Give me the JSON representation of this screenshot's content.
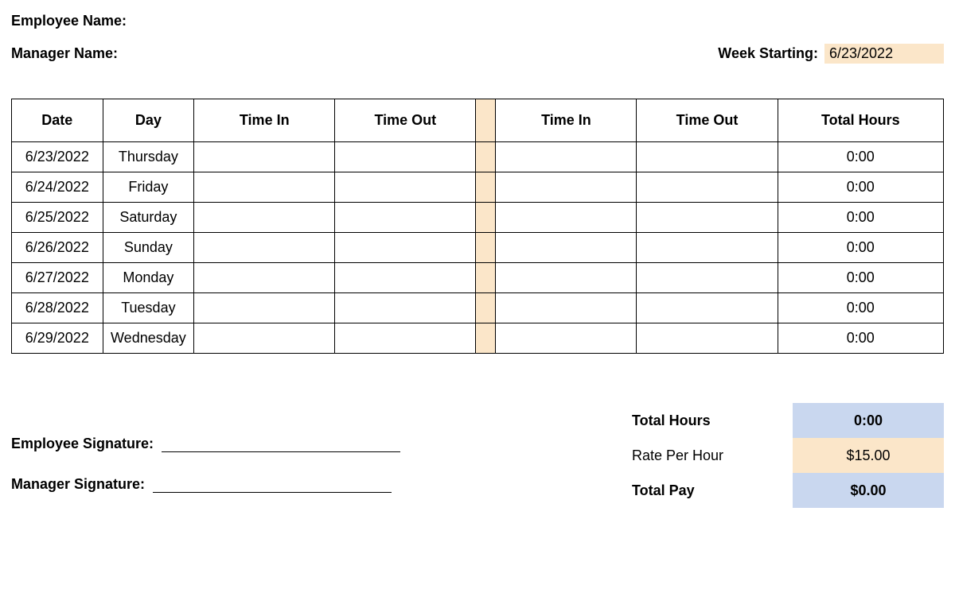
{
  "header": {
    "employee_name_label": "Employee Name:",
    "manager_name_label": "Manager Name:",
    "week_starting_label": "Week Starting:",
    "week_starting_value": "6/23/2022"
  },
  "table": {
    "headers": {
      "date": "Date",
      "day": "Day",
      "time_in_1": "Time In",
      "time_out_1": "Time Out",
      "time_in_2": "Time In",
      "time_out_2": "Time Out",
      "total_hours": "Total Hours"
    },
    "rows": [
      {
        "date": "6/23/2022",
        "day": "Thursday",
        "time_in_1": "",
        "time_out_1": "",
        "time_in_2": "",
        "time_out_2": "",
        "total": "0:00"
      },
      {
        "date": "6/24/2022",
        "day": "Friday",
        "time_in_1": "",
        "time_out_1": "",
        "time_in_2": "",
        "time_out_2": "",
        "total": "0:00"
      },
      {
        "date": "6/25/2022",
        "day": "Saturday",
        "time_in_1": "",
        "time_out_1": "",
        "time_in_2": "",
        "time_out_2": "",
        "total": "0:00"
      },
      {
        "date": "6/26/2022",
        "day": "Sunday",
        "time_in_1": "",
        "time_out_1": "",
        "time_in_2": "",
        "time_out_2": "",
        "total": "0:00"
      },
      {
        "date": "6/27/2022",
        "day": "Monday",
        "time_in_1": "",
        "time_out_1": "",
        "time_in_2": "",
        "time_out_2": "",
        "total": "0:00"
      },
      {
        "date": "6/28/2022",
        "day": "Tuesday",
        "time_in_1": "",
        "time_out_1": "",
        "time_in_2": "",
        "time_out_2": "",
        "total": "0:00"
      },
      {
        "date": "6/29/2022",
        "day": "Wednesday",
        "time_in_1": "",
        "time_out_1": "",
        "time_in_2": "",
        "time_out_2": "",
        "total": "0:00"
      }
    ]
  },
  "signatures": {
    "employee_label": "Employee Signature:",
    "manager_label": "Manager Signature:"
  },
  "totals": {
    "total_hours_label": "Total Hours",
    "total_hours_value": "0:00",
    "rate_label": "Rate Per Hour",
    "rate_value": "$15.00",
    "total_pay_label": "Total Pay",
    "total_pay_value": "$0.00"
  }
}
